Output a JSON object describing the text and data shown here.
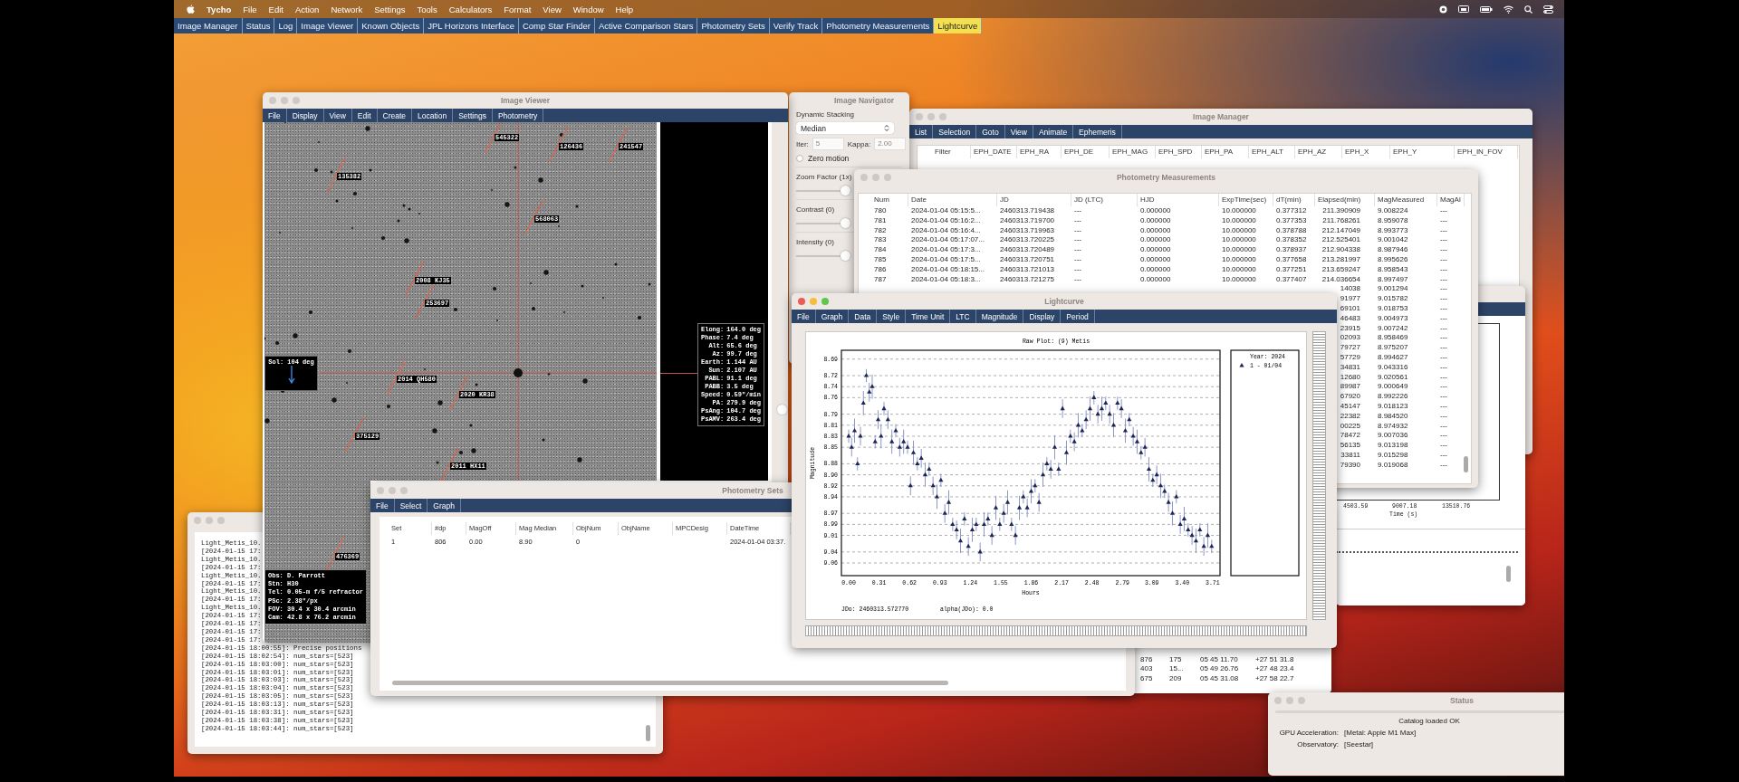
{
  "mac_menu_bar": {
    "app_name": "Tycho",
    "items": [
      "File",
      "Edit",
      "Action",
      "Network",
      "Settings",
      "Tools",
      "Calculators",
      "Format",
      "View",
      "Window",
      "Help"
    ]
  },
  "tab_bar": [
    {
      "label": "Image Manager",
      "selected": false
    },
    {
      "label": "Status",
      "selected": false
    },
    {
      "label": "Log",
      "selected": false
    },
    {
      "label": "Image Viewer",
      "selected": false
    },
    {
      "label": "Known Objects",
      "selected": false
    },
    {
      "label": "JPL Horizons Interface",
      "selected": false
    },
    {
      "label": "Comp Star Finder",
      "selected": false
    },
    {
      "label": "Active Comparison Stars",
      "selected": false
    },
    {
      "label": "Photometry Sets",
      "selected": false
    },
    {
      "label": "Verify Track",
      "selected": false
    },
    {
      "label": "Photometry Measurements",
      "selected": false
    },
    {
      "label": "Lightcurve",
      "selected": true
    }
  ],
  "image_viewer": {
    "title": "Image Viewer",
    "active": false,
    "menus": [
      "File",
      "Display",
      "View",
      "Edit",
      "Create",
      "Location",
      "Settings",
      "Photometry"
    ],
    "asteroid_labels": [
      "545322",
      "126436",
      "241547",
      "135382",
      "568063",
      "2008 KJ35",
      "253697",
      "2014 QH580",
      "2020 KR38",
      "375129",
      "2011 HX11",
      "476369"
    ],
    "sol_label": "Sol: 104 deg",
    "ephemeris": [
      {
        "key": "Elong:",
        "value": "164.0 deg"
      },
      {
        "key": "Phase:",
        "value": "7.4 deg"
      },
      {
        "key": "Alt:",
        "value": "65.6 deg"
      },
      {
        "key": "Az:",
        "value": "99.7 deg"
      },
      {
        "key": "Earth:",
        "value": "1.144 AU"
      },
      {
        "key": "Sun:",
        "value": "2.107 AU"
      },
      {
        "key": "PABL:",
        "value": "91.1 deg"
      },
      {
        "key": "PABB:",
        "value": "3.5 deg"
      },
      {
        "key": "Speed:",
        "value": "0.59\"/min"
      },
      {
        "key": "PA:",
        "value": "279.9 deg"
      },
      {
        "key": "PsAng:",
        "value": "104.7 deg"
      },
      {
        "key": "PsAMV:",
        "value": "263.4 deg"
      }
    ],
    "observer_lines": [
      "Obs: D. Parrott",
      "Stn: H30",
      "Tel: 0.05-m f/5 refractor",
      "PSc: 2.38\"/px",
      "FOV: 30.4 x 30.4 arcmin",
      "Cam: 42.8 x 76.2 arcmin"
    ]
  },
  "image_navigator": {
    "title": "Image Navigator",
    "stacking_label": "Dynamic Stacking",
    "stacking_method": "Median",
    "iter": {
      "label": "Iter:",
      "value": "5",
      "disabled": true
    },
    "kappa": {
      "label": "Kappa:",
      "value": "2.00",
      "disabled": true
    },
    "zero_motion": {
      "label": "Zero motion",
      "checked": false
    },
    "sliders": [
      {
        "label": "Zoom Factor (1x)",
        "level": 1
      },
      {
        "label": "Contrast (0)",
        "level": 1
      },
      {
        "label": "Intensity (0)",
        "level": 1
      }
    ]
  },
  "image_manager": {
    "title": "Image Manager",
    "active": false,
    "menus": [
      "List",
      "Selection",
      "Goto",
      "View",
      "Animate",
      "Ephemeris"
    ],
    "columns": [
      "Filter",
      "EPH_DATE",
      "EPH_RA",
      "EPH_DE",
      "EPH_MAG",
      "EPH_SPD",
      "EPH_PA",
      "EPH_ALT",
      "EPH_AZ",
      "EPH_X",
      "EPH_Y",
      "EPH_IN_FOV"
    ]
  },
  "photometry_measurements": {
    "title": "Photometry Measurements",
    "active": false,
    "columns": [
      "Num",
      "Date",
      "JD",
      "JD (LTC)",
      "HJD",
      "ExpTime(sec)",
      "dT(min)",
      "Elapsed(min)",
      "MagMeasured",
      "MagAl"
    ],
    "rows": [
      [
        "780",
        "2024-01-04 05:15:5...",
        "2460313.719438",
        "---",
        "0.000000",
        "10.000000",
        "0.377312",
        "211.390909",
        "9.008224",
        "---"
      ],
      [
        "781",
        "2024-01-04 05:16:2...",
        "2460313.719700",
        "---",
        "0.000000",
        "10.000000",
        "0.377353",
        "211.768261",
        "8.959078",
        "---"
      ],
      [
        "782",
        "2024-01-04 05:16:4...",
        "2460313.719963",
        "---",
        "0.000000",
        "10.000000",
        "0.378788",
        "212.147049",
        "8.993773",
        "---"
      ],
      [
        "783",
        "2024-01-04 05:17:07...",
        "2460313.720225",
        "---",
        "0.000000",
        "10.000000",
        "0.378352",
        "212.525401",
        "9.001042",
        "---"
      ],
      [
        "784",
        "2024-01-04 05:17:3...",
        "2460313.720489",
        "---",
        "0.000000",
        "10.000000",
        "0.378937",
        "212.904338",
        "8.987946",
        "---"
      ],
      [
        "785",
        "2024-01-04 05:17:5...",
        "2460313.720751",
        "---",
        "0.000000",
        "10.000000",
        "0.377658",
        "213.281997",
        "8.995626",
        "---"
      ],
      [
        "786",
        "2024-01-04 05:18:15...",
        "2460313.721013",
        "---",
        "0.000000",
        "10.000000",
        "0.377251",
        "213.659247",
        "8.958543",
        "---"
      ],
      [
        "787",
        "2024-01-04 05:18:3...",
        "2460313.721275",
        "---",
        "0.000000",
        "10.000000",
        "0.377407",
        "214.036654",
        "8.997497",
        "---"
      ]
    ],
    "rows_right_part": [
      [
        "14038",
        "9.001294",
        "---"
      ],
      [
        "91977",
        "9.015782",
        "---"
      ],
      [
        "69101",
        "9.018753",
        "---"
      ],
      [
        "46483",
        "9.004973",
        "---"
      ],
      [
        "23915",
        "9.007242",
        "---"
      ],
      [
        "02093",
        "8.958469",
        "---"
      ],
      [
        "79727",
        "8.975207",
        "---"
      ],
      [
        "57729",
        "8.994627",
        "---"
      ],
      [
        "34831",
        "9.043316",
        "---"
      ],
      [
        "12680",
        "9.020561",
        "---"
      ],
      [
        "89987",
        "9.000649",
        "---"
      ],
      [
        "67920",
        "8.992226",
        "---"
      ],
      [
        "45147",
        "9.018123",
        "---"
      ],
      [
        "22382",
        "8.984520",
        "---"
      ],
      [
        "00225",
        "8.974932",
        "---"
      ],
      [
        "78472",
        "9.007036",
        "---"
      ],
      [
        "56135",
        "9.013198",
        "---"
      ],
      [
        "33811",
        "9.015298",
        "---"
      ],
      [
        "79390",
        "9.019068",
        "---"
      ]
    ]
  },
  "time_graph_window": {
    "xtick_labels": [
      "4503.59",
      "9007.18",
      "13510.76"
    ],
    "xlabel": "Time (s)"
  },
  "lightcurve": {
    "title": "Lightcurve",
    "active": true,
    "menus": [
      "File",
      "Graph",
      "Data",
      "Style",
      "Time Unit",
      "LTC",
      "Magnitude",
      "Display",
      "Period"
    ],
    "chart_data": {
      "type": "scatter",
      "grid": true,
      "title": "Raw Plot: (9) Metis",
      "xlabel": "Hours",
      "ylabel": "Magnitude",
      "x": [
        0.0,
        0.03,
        0.06,
        0.09,
        0.12,
        0.15,
        0.18,
        0.21,
        0.24,
        0.27,
        0.3,
        0.33,
        0.36,
        0.4,
        0.44,
        0.48,
        0.52,
        0.56,
        0.6,
        0.63,
        0.66,
        0.7,
        0.74,
        0.78,
        0.82,
        0.86,
        0.9,
        0.94,
        0.98,
        1.02,
        1.06,
        1.1,
        1.14,
        1.18,
        1.22,
        1.26,
        1.3,
        1.34,
        1.38,
        1.42,
        1.46,
        1.5,
        1.54,
        1.58,
        1.62,
        1.66,
        1.7,
        1.74,
        1.78,
        1.82,
        1.86,
        1.9,
        1.94,
        1.98,
        2.02,
        2.06,
        2.1,
        2.14,
        2.18,
        2.22,
        2.26,
        2.3,
        2.34,
        2.38,
        2.42,
        2.46,
        2.5,
        2.54,
        2.58,
        2.62,
        2.66,
        2.7,
        2.74,
        2.78,
        2.82,
        2.86,
        2.9,
        2.94,
        2.98,
        3.02,
        3.06,
        3.1,
        3.14,
        3.18,
        3.22,
        3.26,
        3.3,
        3.34,
        3.38,
        3.42,
        3.46,
        3.5,
        3.54,
        3.58,
        3.62,
        3.66,
        3.7
      ],
      "series": [
        {
          "name": "1 - 01/04",
          "color": "#1b2556",
          "values": [
            8.83,
            8.85,
            8.82,
            8.88,
            8.83,
            8.77,
            8.72,
            8.75,
            8.74,
            8.84,
            8.8,
            8.83,
            8.78,
            8.8,
            8.84,
            8.82,
            8.85,
            8.84,
            8.85,
            8.92,
            8.86,
            8.88,
            8.87,
            8.9,
            8.89,
            8.92,
            8.94,
            8.91,
            8.97,
            8.95,
            8.99,
            9.0,
            9.02,
            8.98,
            9.03,
            9.0,
            8.99,
            9.04,
            8.99,
            8.98,
            9.01,
            8.96,
            8.99,
            8.97,
            8.95,
            8.99,
            9.01,
            8.96,
            8.94,
            8.96,
            8.93,
            8.92,
            8.95,
            8.9,
            8.88,
            8.89,
            8.85,
            8.89,
            8.78,
            8.86,
            8.83,
            8.84,
            8.81,
            8.82,
            8.8,
            8.78,
            8.76,
            8.79,
            8.78,
            8.77,
            8.79,
            8.81,
            8.77,
            8.78,
            8.82,
            8.8,
            8.83,
            8.84,
            8.86,
            8.85,
            8.89,
            8.91,
            8.9,
            8.92,
            8.93,
            8.95,
            8.97,
            8.94,
            8.99,
            8.98,
            9.0,
            9.01,
            9.02,
            9.0,
            9.03,
            9.01,
            9.03
          ]
        }
      ],
      "xlim": [
        -0.074,
        3.785
      ],
      "ylim": [
        9.083,
        8.674
      ],
      "xticks": [
        {
          "value": 0,
          "label": "0.00"
        },
        {
          "value": 0.31,
          "label": "0.31"
        },
        {
          "value": 0.62,
          "label": "0.62"
        },
        {
          "value": 0.93,
          "label": "0.93"
        },
        {
          "value": 1.24,
          "label": "1.24"
        },
        {
          "value": 1.55,
          "label": "1.55"
        },
        {
          "value": 1.86,
          "label": "1.86"
        },
        {
          "value": 2.17,
          "label": "2.17"
        },
        {
          "value": 2.48,
          "label": "2.48"
        },
        {
          "value": 2.79,
          "label": "2.79"
        },
        {
          "value": 3.09,
          "label": "3.09"
        },
        {
          "value": 3.4,
          "label": "3.40"
        },
        {
          "value": 3.71,
          "label": "3.71"
        }
      ],
      "yticks": [
        8.69,
        8.72,
        8.74,
        8.76,
        8.79,
        8.81,
        8.83,
        8.85,
        8.88,
        {
          "value": 8.9,
          "label": "8.90"
        },
        8.92,
        8.94,
        8.97,
        8.99,
        9.01,
        9.04,
        9.06
      ]
    },
    "legend_title": "Year: 2024",
    "jdo": "JDo: 2460313.572770",
    "alpha": "alpha(JDo): 0.0"
  },
  "log_window": {
    "active": false,
    "lines": [
      "Light_Metis_10.",
      "[2024-01-15 17:",
      "Light_Metis_10.",
      "[2024-01-15 17:",
      "Light_Metis_10.",
      "[2024-01-15 17:",
      "Light_Metis_10.",
      "[2024-01-15 17:",
      "Light_Metis_10.",
      "[2024-01-15 17:",
      "[2024-01-15 17:",
      "[2024-01-15 17:",
      "[2024-01-15 17:",
      "[2024-01-15 18:00:55]: Precise positions",
      "[2024-01-15 18:02:54]: num_stars=[523]",
      "[2024-01-15 18:03:00]: num_stars=[523]",
      "[2024-01-15 18:03:01]: num_stars=[523]",
      "[2024-01-15 18:03:03]: num_stars=[523]",
      "[2024-01-15 18:03:04]: num_stars=[523]",
      "[2024-01-15 18:03:05]: num_stars=[523]",
      "[2024-01-15 18:03:13]: num_stars=[523]",
      "[2024-01-15 18:03:31]: num_stars=[523]",
      "[2024-01-15 18:03:38]: num_stars=[523]",
      "[2024-01-15 18:03:44]: num_stars=[523]"
    ]
  },
  "photometry_sets": {
    "title": "Photometry Sets",
    "active": false,
    "menus": [
      "File",
      "Select",
      "Graph"
    ],
    "columns": [
      "Set",
      "#dp",
      "MagOff",
      "Mag Median",
      "ObjNum",
      "ObjName",
      "MPCDesig",
      "DateTime"
    ],
    "rows": [
      {
        "set": "1",
        "dp": "806",
        "mag_off": "0.00",
        "mag_median": "8.90",
        "obj_num": "0",
        "datetime": "2024-01-04 03:37."
      }
    ]
  },
  "known_objects_window": {
    "rows": [
      [
        "876",
        "175",
        "05 45 11.70",
        "+27 51 31.8"
      ],
      [
        "403",
        "15...",
        "05 49 26.76",
        "+27 48 23.4"
      ],
      [
        "675",
        "209",
        "05 45 31.08",
        "+27 58 22.7"
      ]
    ]
  },
  "status_window": {
    "title": "Status",
    "active": false,
    "progress": {
      "level": 0
    },
    "message": "Catalog loaded OK",
    "fields": [
      {
        "label": "GPU Acceleration:",
        "value": "[Metal: Apple M1 Max]"
      },
      {
        "label": "Observatory:",
        "value": "[Seestar]"
      }
    ]
  }
}
